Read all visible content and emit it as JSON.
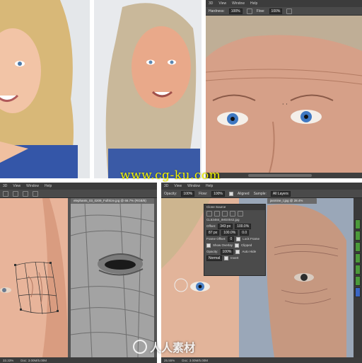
{
  "watermarks": {
    "main": "www.cg-ku.com",
    "logo_text": "人人素材"
  },
  "top_right": {
    "menu": [
      "3D",
      "View",
      "Window",
      "Help"
    ],
    "opt_hardness_label": "Hardness:",
    "opt_hardness_value": "100%",
    "opt_flow_label": "Flow:",
    "opt_flow_value": "100%"
  },
  "bottom_left": {
    "menu": [
      "3D",
      "View",
      "Window",
      "Help"
    ],
    "doc_tab": "elephants_03_0209_FullSize.jpg @ 66.7% (RGB/8)",
    "status_zoom": "33.33%",
    "status_doc": "Doc: 3.00M/5.00M"
  },
  "bottom_right": {
    "menu": [
      "3D",
      "View",
      "Window",
      "Help"
    ],
    "opt_opacity_label": "Opacity:",
    "opt_opacity_value": "100%",
    "opt_flow_label": "Flow:",
    "opt_flow_value": "100%",
    "opt_aligned": "Aligned",
    "opt_sample_label": "Sample:",
    "opt_sample_value": "All Layers",
    "doc_tab": "jasmine_t.jpg @ 28.4%",
    "clone_panel": {
      "title": "Clone Source",
      "source_file": "CL53484_IMG0042.jpg",
      "offset_label": "Offset:",
      "x_value": "343 px",
      "y_value": "87 px",
      "w_value": "100.0%",
      "h_value": "100.0%",
      "angle_value": "0.0",
      "frame_offset_label": "Frame Offset:",
      "frame_offset_value": "0",
      "lock_frame": "Lock Frame",
      "show_overlay": "Show Overlay",
      "opacity_label": "Opacity:",
      "opacity_value": "100%",
      "clipped": "Clipped",
      "auto_hide": "Auto Hide",
      "invert": "Invert",
      "blend_value": "Normal"
    },
    "status_zoom": "25.55%",
    "status_doc": "Doc: 3.00M/5.00M"
  },
  "colors": {
    "ps_chrome": "#3c3c3c",
    "ps_canvas": "#535353",
    "watermark_yellow": "#f2f200",
    "layer_eye_green": "#4b9a3a"
  }
}
